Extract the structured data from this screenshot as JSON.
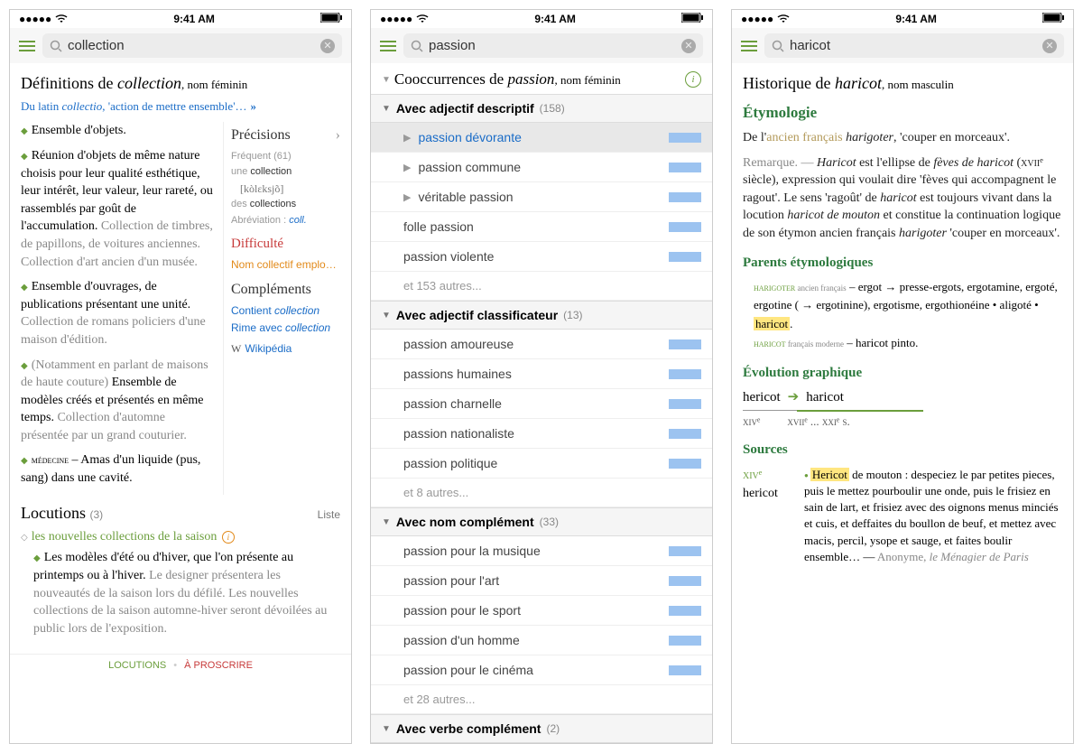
{
  "status": {
    "time": "9:41 AM"
  },
  "phone1": {
    "search": "collection",
    "headline_prefix": "Définitions de ",
    "headline_word": "collection",
    "headline_pos": ", nom féminin",
    "etym": "Du latin ",
    "etym_word": "collectio",
    "etym_rest": ", 'action de mettre ensemble'…",
    "etym_arrow": "»",
    "defs": [
      {
        "main": "Ensemble d'objets.",
        "grey": ""
      },
      {
        "main": "Réunion d'objets de même nature choisis pour leur qualité esthétique, leur intérêt, leur valeur, leur rareté, ou rassemblés par goût de l'accumulation.",
        "grey": "Collection de timbres, de papillons, de voitures anciennes. Collection d'art ancien d'un musée."
      },
      {
        "main": "Ensemble d'ouvrages, de publications présentant une unité.",
        "grey": "Collection de romans policiers d'une maison d'édition."
      },
      {
        "note": "(Notamment en parlant de maisons de haute couture)",
        "main": " Ensemble de modèles créés et présentés en même temps.",
        "grey": "Collection d'automne présentée par un grand couturier."
      },
      {
        "tag": "médecine",
        "main": " – Amas d'un liquide (pus, sang) dans une cavité."
      }
    ],
    "right": {
      "precisions": "Précisions",
      "freq": "Fréquent (61)",
      "une": "une ",
      "word1": "collection",
      "phon": "[kòlɛksjõ]",
      "des": "des ",
      "word2": "collections",
      "abbr_label": "Abréviation : ",
      "abbr": "coll.",
      "difficulte": "Difficulté",
      "nom_coll": "Nom collectif emplo…",
      "complements": "Compléments",
      "contient": "Contient ",
      "contient_it": "collection",
      "rime": "Rime avec ",
      "rime_it": "collection",
      "wiki": "Wikipédia"
    },
    "locutions": "Locutions",
    "loc_count": "(3)",
    "liste": "Liste",
    "loc1": "les nouvelles collections de la saison",
    "loc1_def": "Les modèles d'été ou d'hiver, que l'on présente au printemps ou à l'hiver.",
    "loc1_grey": " Le designer présentera les nouveautés de la saison lors du défilé. Les nouvelles collections de la saison automne-hiver seront dévoilées au public lors de l'exposition.",
    "bottom1": "LOCUTIONS",
    "bottom2": "À PROSCRIRE"
  },
  "phone2": {
    "search": "passion",
    "title_prefix": "Cooccurrences de ",
    "title_word": "passion",
    "title_pos": ", nom féminin",
    "sections": [
      {
        "label": "Avec adjectif descriptif",
        "count": "(158)",
        "items": [
          {
            "t": "passion dévorante",
            "sel": true,
            "exp": true
          },
          {
            "t": "passion commune",
            "exp": true
          },
          {
            "t": "véritable passion",
            "exp": true
          },
          {
            "t": "folle passion"
          },
          {
            "t": "passion violente"
          }
        ],
        "more": "et 153 autres..."
      },
      {
        "label": "Avec adjectif classificateur",
        "count": "(13)",
        "items": [
          {
            "t": "passion amoureuse"
          },
          {
            "t": "passions humaines"
          },
          {
            "t": "passion charnelle"
          },
          {
            "t": "passion nationaliste"
          },
          {
            "t": "passion politique"
          }
        ],
        "more": "et 8 autres..."
      },
      {
        "label": "Avec nom complément",
        "count": "(33)",
        "items": [
          {
            "t": "passion pour la musique"
          },
          {
            "t": "passion pour l'art"
          },
          {
            "t": "passion pour le sport"
          },
          {
            "t": "passion d'un homme"
          },
          {
            "t": "passion pour le cinéma"
          }
        ],
        "more": "et 28 autres..."
      },
      {
        "label": "Avec verbe complément",
        "count": "(2)",
        "items": []
      }
    ]
  },
  "phone3": {
    "search": "haricot",
    "headline_prefix": "Historique de ",
    "headline_word": "haricot",
    "headline_pos": ", nom masculin",
    "etym_head": "Étymologie",
    "etym_p1a": "De l'",
    "etym_p1b": "ancien français",
    "etym_p1c": " harigoter",
    "etym_p1d": ", 'couper en morceaux'.",
    "rem_label": "Remarque. — ",
    "rem_it1": "Haricot",
    "rem_1": " est l'ellipse de ",
    "rem_it2": "fèves de haricot",
    "rem_2": " (",
    "rem_sc": "xviiᵉ",
    "rem_3": " siècle), expression qui voulait dire 'fèves qui accompagnent le ragout'. Le sens 'ragoût' de ",
    "rem_it3": "haricot",
    "rem_4": " est toujours vivant dans la locution ",
    "rem_it4": "haricot de mouton",
    "rem_5": " et constitue la continuation logique de son étymon ancien français ",
    "rem_it5": "harigoter",
    "rem_6": " 'couper en morceaux'.",
    "parents_head": "Parents étymologiques",
    "par1_sc": "harigoter",
    "par1_t": " ancien français",
    "par1_rest": " – ergot → presse-ergots, ergotamine, ergoté, ergotine ( → ergotinine), ergotisme, ergothionéine • aligoté • ",
    "par1_hl": "haricot",
    "par2_sc": "haricot",
    "par2_t": " français moderne",
    "par2_rest": " – haricot pinto.",
    "evol_head": "Évolution graphique",
    "evol_w1": "hericot",
    "evol_w2": "haricot",
    "cent1": "xivᵉ",
    "cent2": "xviiᵉ ... xxiᵉ s.",
    "sources_head": "Sources",
    "src_date": "xivᵉ",
    "src_form": "hericot",
    "src_hl": "Hericot",
    "src_txt": " de mouton : despeciez le par petites pieces, puis le mettez pourboulir une onde, puis le frisiez en sain de lart, et frisiez avec des oignons menus minciés et cuis, et deffaites du boullon de beuf, et mettez avec macis, percil, ysope et sauge, et faites boulir ensemble… — ",
    "src_auth": "Anonyme, ",
    "src_title": "le Ménagier de Paris"
  }
}
